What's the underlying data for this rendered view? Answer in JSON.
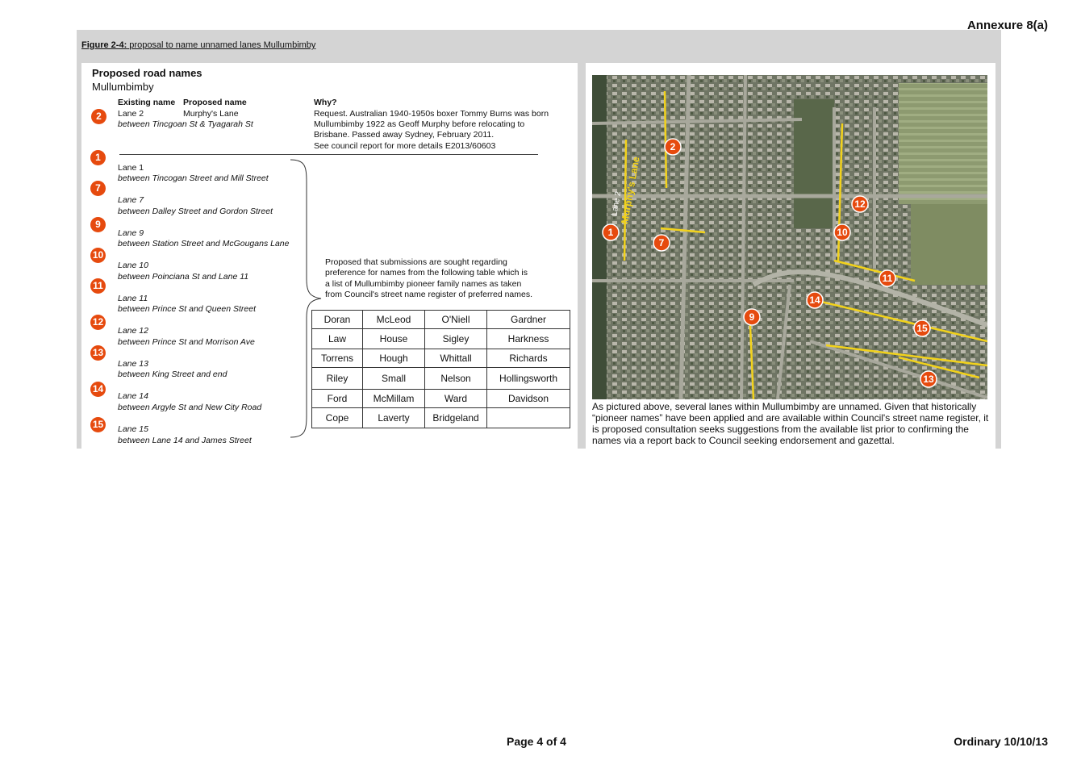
{
  "annexure": "Annexure 8(a)",
  "figure": {
    "label": "Figure 2-4:",
    "title": "proposal to name unnamed lanes Mullumbimby"
  },
  "heading": {
    "title": "Proposed road names",
    "subtitle": "Mullumbimby"
  },
  "table_header": {
    "existing": "Existing name",
    "proposed": "Proposed name",
    "why": "Why?"
  },
  "lane2": {
    "badge": "2",
    "existing": "Lane 2",
    "proposed": "Murphy's Lane",
    "between": "between Tincgoan St & Tyagarah St",
    "why_lines": [
      "Request. Australian 1940-1950s boxer Tommy Burns was born",
      "Mullumbimby 1922 as Geoff Murphy before relocating to",
      "Brisbane. Passed away Sydney, February 2011.",
      "See council report for more details E2013/60603"
    ]
  },
  "lanes": [
    {
      "badge": "1",
      "name": "Lane 1",
      "between": "between Tincogan Street and Mill Street"
    },
    {
      "badge": "7",
      "name": "Lane 7",
      "between": "between Dalley Street and Gordon Street"
    },
    {
      "badge": "9",
      "name": "Lane 9",
      "between": "between Station Street and McGougans Lane"
    },
    {
      "badge": "10",
      "name": "Lane 10",
      "between": "between Poinciana St and Lane 11"
    },
    {
      "badge": "11",
      "name": "Lane 11",
      "between": "between Prince St and Queen Street"
    },
    {
      "badge": "12",
      "name": "Lane 12",
      "between": "between Prince St and Morrison Ave"
    },
    {
      "badge": "13",
      "name": "Lane 13",
      "between": "between King Street and end"
    },
    {
      "badge": "14",
      "name": "Lane 14",
      "between": "between Argyle St and New City Road"
    },
    {
      "badge": "15",
      "name": "Lane 15",
      "between": "between Lane 14 and James Street"
    }
  ],
  "proposal_lines": [
    "Proposed that submissions are sought regarding",
    "preference for names from the following table which is",
    "a list of Mullumbimby pioneer family names as taken",
    "from Council's street name register of preferred names."
  ],
  "pioneer_names": [
    [
      "Doran",
      "McLeod",
      "O'Niell",
      "Gardner"
    ],
    [
      "Law",
      "House",
      "Sigley",
      "Harkness"
    ],
    [
      "Torrens",
      "Hough",
      "Whittall",
      "Richards"
    ],
    [
      "Riley",
      "Small",
      "Nelson",
      "Hollingsworth"
    ],
    [
      "Ford",
      "McMillam",
      "Ward",
      "Davidson"
    ],
    [
      "Cope",
      "Laverty",
      "Bridgeland",
      ""
    ]
  ],
  "map": {
    "lane_label": "Lane 2",
    "highlight_label": "Murphy's Lane",
    "markers": [
      "1",
      "2",
      "7",
      "9",
      "10",
      "11",
      "12",
      "13",
      "14",
      "15"
    ],
    "colors": {
      "marker": "#e64a0e",
      "lane": "#f2d21b"
    }
  },
  "caption": "As pictured above, several lanes within Mullumbimby are unnamed. Given that historically “pioneer names” have been applied and are available within Council's street name register, it is proposed consultation seeks suggestions from the available list prior to confirming the names via a report back to Council seeking endorsement and gazettal.",
  "footer": {
    "page": "Page 4 of 4",
    "meeting": "Ordinary 10/10/13"
  }
}
